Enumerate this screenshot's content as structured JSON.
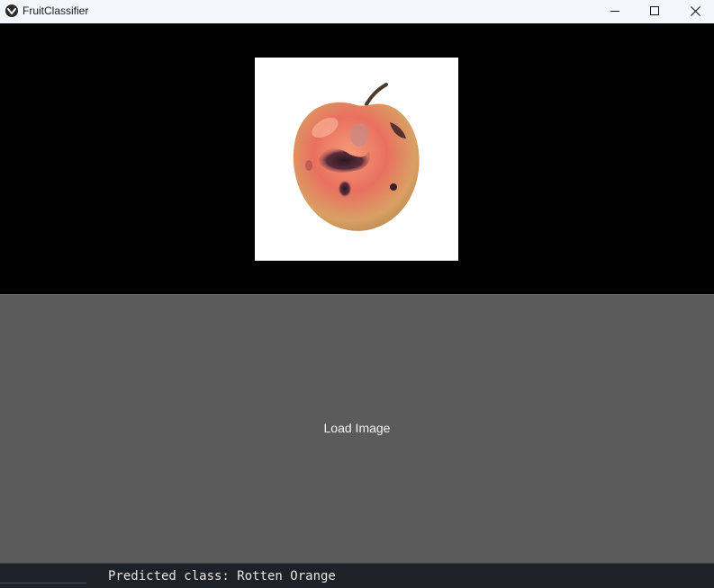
{
  "window": {
    "title": "FruitClassifier"
  },
  "image_panel": {
    "image_description": "apple-with-rotten-spots"
  },
  "load_button": {
    "label": "Load Image"
  },
  "status": {
    "predicted_text": "Predicted class: Rotten Orange"
  },
  "colors": {
    "title_bar": "#f3f6fb",
    "image_background": "#000000",
    "button_background": "#5b5b5b",
    "status_background": "#1f2128"
  }
}
